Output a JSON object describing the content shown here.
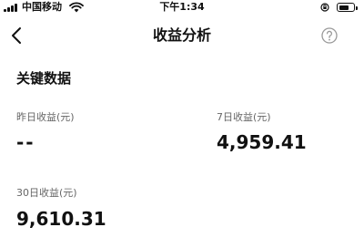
{
  "status_bar": {
    "carrier": "中国移动",
    "time": "下午1:34",
    "battery_level": 0.75,
    "icons": [
      "signal-icon",
      "wifi-icon",
      "rotation-lock-icon",
      "battery-icon"
    ]
  },
  "nav": {
    "title": "收益分析",
    "back_icon": "chevron-left-icon",
    "help_icon": "question-circle-icon"
  },
  "section": {
    "title": "关键数据"
  },
  "metrics": {
    "yesterday": {
      "label": "昨日收益(元)",
      "value": "--"
    },
    "seven_day": {
      "label": "7日收益(元)",
      "value": "4,959.41"
    },
    "thirty_day": {
      "label": "30日收益(元)",
      "value": "9,610.31"
    }
  },
  "colors": {
    "text_primary": "#111111",
    "text_secondary": "#666666",
    "icon_gray": "#999999",
    "background": "#ffffff"
  }
}
